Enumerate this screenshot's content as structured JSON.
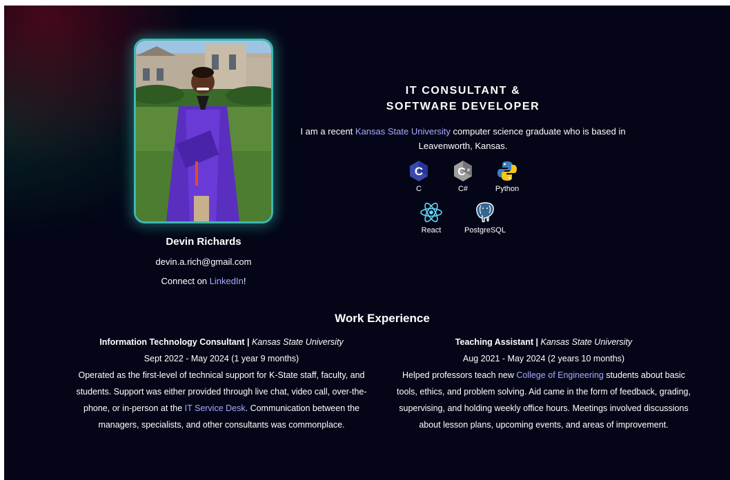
{
  "profile": {
    "name": "Devin Richards",
    "email": "devin.a.rich@gmail.com",
    "connect_prefix": "Connect on ",
    "connect_link": "LinkedIn",
    "connect_suffix": "!"
  },
  "hero": {
    "title_line1": "IT CONSULTANT &",
    "title_line2": "SOFTWARE DEVELOPER",
    "desc_pre": "I am a recent ",
    "desc_link": "Kansas State University",
    "desc_post": " computer science graduate who is based in Leavenworth, Kansas."
  },
  "skills": [
    {
      "label": "C",
      "icon": "c-icon"
    },
    {
      "label": "C#",
      "icon": "csharp-icon"
    },
    {
      "label": "Python",
      "icon": "python-icon"
    },
    {
      "label": "React",
      "icon": "react-icon"
    },
    {
      "label": "PostgreSQL",
      "icon": "postgresql-icon"
    }
  ],
  "work": {
    "title": "Work Experience",
    "jobs": [
      {
        "role": "Information Technology Consultant",
        "sep": " | ",
        "org": "Kansas State University",
        "dates": "Sept 2022 - May 2024 (1 year 9 months)",
        "desc_pre": "Operated as the first-level of technical support for K-State staff, faculty, and students. Support was either provided through live chat, video call, over-the-phone, or in-person at the ",
        "desc_link": "IT Service Desk",
        "desc_post": ". Communication between the managers, specialists, and other consultants was commonplace."
      },
      {
        "role": "Teaching Assistant",
        "sep": " | ",
        "org": "Kansas State University",
        "dates": "Aug 2021 - May 2024 (2 years 10 months)",
        "desc_pre": "Helped professors teach new ",
        "desc_link": "College of Engineering",
        "desc_post": " students about basic tools, ethics, and problem solving. Aid came in the form of feedback, grading, supervising, and holding weekly office hours. Meetings involved discussions about lesson plans, upcoming events, and areas of improvement."
      }
    ]
  },
  "colors": {
    "background": "#040617",
    "link": "#a8a8ff",
    "frame": "#3fb8b0"
  }
}
